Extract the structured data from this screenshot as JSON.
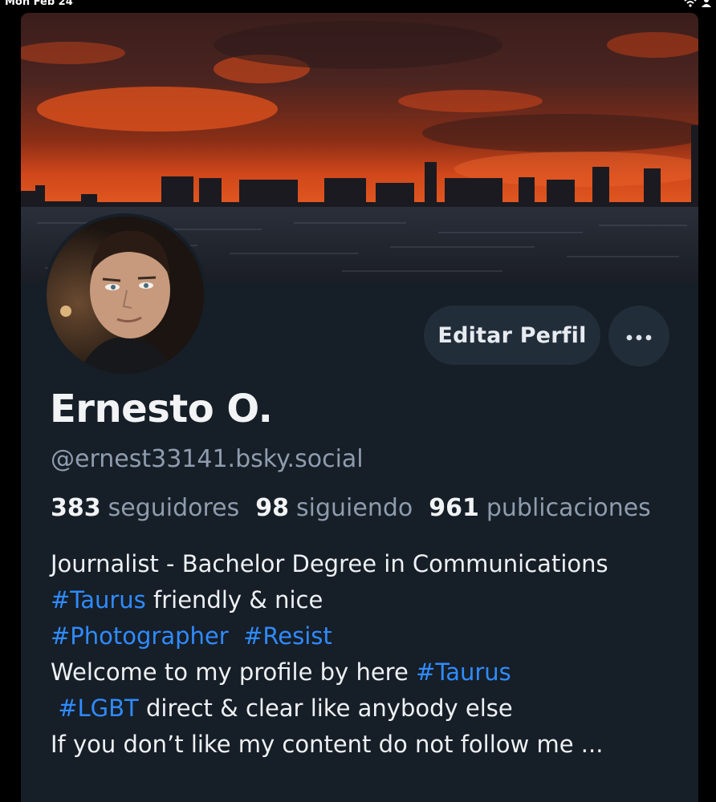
{
  "status_bar": {
    "time": "Mon Feb 24",
    "icons": [
      "wifi-icon",
      "person-icon"
    ]
  },
  "profile": {
    "display_name": "Ernesto O.",
    "handle": "@ernest33141.bsky.social",
    "edit_label": "Editar Perfil",
    "more_label": "•••",
    "stats": {
      "followers_count": "383",
      "followers_label": "seguidores",
      "following_count": "98",
      "following_label": "siguiendo",
      "posts_count": "961",
      "posts_label": "publicaciones"
    },
    "bio": {
      "line1": "Journalist - Bachelor Degree in Communications",
      "line2_tag": "#Taurus",
      "line2_text": " friendly & nice",
      "line3_tag1": "#Photographer",
      "line3_sep": "  ",
      "line3_tag2": "#Resist",
      "line4_text": "Welcome to my profile by here ",
      "line4_tag": "#Taurus",
      "line5_lead": " ",
      "line5_tag": "#LGBT",
      "line5_text": " direct & clear like anybody else",
      "line6": "If you don’t like my content do not follow me ..."
    }
  },
  "colors": {
    "background": "#161e27",
    "button": "#222d3a",
    "hashtag": "#2f8bff",
    "muted": "#8e9cae"
  }
}
